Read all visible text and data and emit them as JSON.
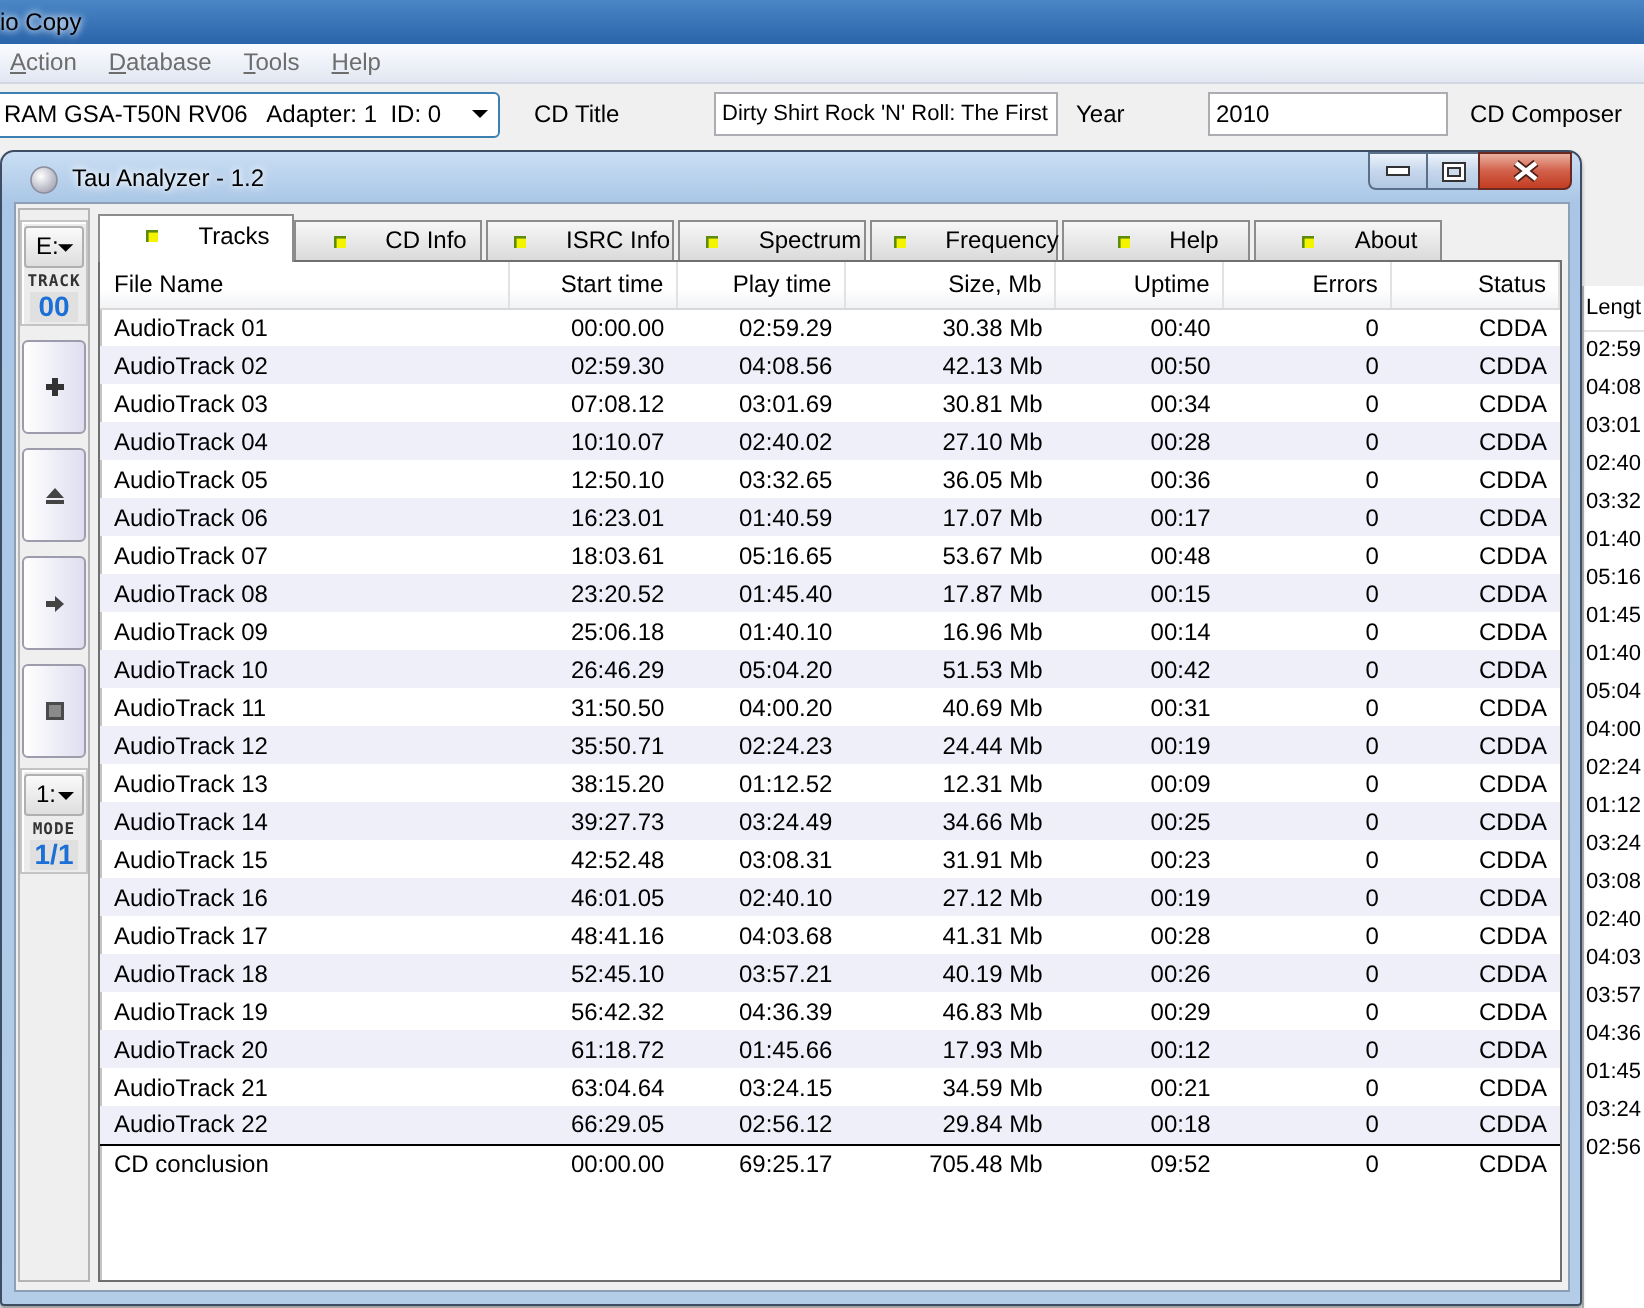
{
  "app_window": {
    "title": "io Copy",
    "menu": [
      "Action",
      "Database",
      "Tools",
      "Help"
    ],
    "device_select": {
      "value": "RAM GSA-T50N RV06   Adapter: 1  ID: 0"
    },
    "fields": [
      {
        "label": "CD Title",
        "value": "Dirty Shirt Rock 'N' Roll: The First"
      },
      {
        "label": "Year",
        "value": "2010"
      },
      {
        "label": "CD Composer"
      }
    ],
    "track_list": {
      "columns": [
        "Lengt"
      ],
      "rows": [
        "02:59",
        "04:08",
        "03:01",
        "02:40",
        "03:32",
        "01:40",
        "05:16",
        "01:45",
        "01:40",
        "05:04",
        "04:00",
        "02:24",
        "01:12",
        "03:24",
        "03:08",
        "02:40",
        "04:03",
        "03:57",
        "04:36",
        "01:45",
        "03:24",
        "02:56"
      ]
    }
  },
  "analyzer_window": {
    "title": "Tau Analyzer - 1.2",
    "toolbar": {
      "drive_select": "E:",
      "track_label": "TRACK",
      "track": "00",
      "buttons": [
        {
          "kind": "add"
        },
        {
          "kind": "eject"
        },
        {
          "kind": "next"
        },
        {
          "kind": "stop"
        }
      ],
      "mode_select": "1:",
      "mode_label": "MODE",
      "mode": "1/1"
    },
    "tabs": [
      {
        "label": "Tracks",
        "selected": true
      },
      {
        "label": "CD Info",
        "selected": false
      },
      {
        "label": "ISRC Info",
        "selected": false
      },
      {
        "label": "Spectrum",
        "selected": false
      },
      {
        "label": "Frequency",
        "selected": false
      },
      {
        "label": "Help",
        "selected": false
      },
      {
        "label": "About",
        "selected": false
      }
    ],
    "table": {
      "columns": [
        "File Name",
        "Start time",
        "Play time",
        "Size, Mb",
        "Uptime",
        "Errors",
        "Status"
      ],
      "rows": [
        [
          "AudioTrack 01",
          "00:00.00",
          "02:59.29",
          "30.38 Mb",
          "00:40",
          "0",
          "CDDA"
        ],
        [
          "AudioTrack 02",
          "02:59.30",
          "04:08.56",
          "42.13 Mb",
          "00:50",
          "0",
          "CDDA"
        ],
        [
          "AudioTrack 03",
          "07:08.12",
          "03:01.69",
          "30.81 Mb",
          "00:34",
          "0",
          "CDDA"
        ],
        [
          "AudioTrack 04",
          "10:10.07",
          "02:40.02",
          "27.10 Mb",
          "00:28",
          "0",
          "CDDA"
        ],
        [
          "AudioTrack 05",
          "12:50.10",
          "03:32.65",
          "36.05 Mb",
          "00:36",
          "0",
          "CDDA"
        ],
        [
          "AudioTrack 06",
          "16:23.01",
          "01:40.59",
          "17.07 Mb",
          "00:17",
          "0",
          "CDDA"
        ],
        [
          "AudioTrack 07",
          "18:03.61",
          "05:16.65",
          "53.67 Mb",
          "00:48",
          "0",
          "CDDA"
        ],
        [
          "AudioTrack 08",
          "23:20.52",
          "01:45.40",
          "17.87 Mb",
          "00:15",
          "0",
          "CDDA"
        ],
        [
          "AudioTrack 09",
          "25:06.18",
          "01:40.10",
          "16.96 Mb",
          "00:14",
          "0",
          "CDDA"
        ],
        [
          "AudioTrack 10",
          "26:46.29",
          "05:04.20",
          "51.53 Mb",
          "00:42",
          "0",
          "CDDA"
        ],
        [
          "AudioTrack 11",
          "31:50.50",
          "04:00.20",
          "40.69 Mb",
          "00:31",
          "0",
          "CDDA"
        ],
        [
          "AudioTrack 12",
          "35:50.71",
          "02:24.23",
          "24.44 Mb",
          "00:19",
          "0",
          "CDDA"
        ],
        [
          "AudioTrack 13",
          "38:15.20",
          "01:12.52",
          "12.31 Mb",
          "00:09",
          "0",
          "CDDA"
        ],
        [
          "AudioTrack 14",
          "39:27.73",
          "03:24.49",
          "34.66 Mb",
          "00:25",
          "0",
          "CDDA"
        ],
        [
          "AudioTrack 15",
          "42:52.48",
          "03:08.31",
          "31.91 Mb",
          "00:23",
          "0",
          "CDDA"
        ],
        [
          "AudioTrack 16",
          "46:01.05",
          "02:40.10",
          "27.12 Mb",
          "00:19",
          "0",
          "CDDA"
        ],
        [
          "AudioTrack 17",
          "48:41.16",
          "04:03.68",
          "41.31 Mb",
          "00:28",
          "0",
          "CDDA"
        ],
        [
          "AudioTrack 18",
          "52:45.10",
          "03:57.21",
          "40.19 Mb",
          "00:26",
          "0",
          "CDDA"
        ],
        [
          "AudioTrack 19",
          "56:42.32",
          "04:36.39",
          "46.83 Mb",
          "00:29",
          "0",
          "CDDA"
        ],
        [
          "AudioTrack 20",
          "61:18.72",
          "01:45.66",
          "17.93 Mb",
          "00:12",
          "0",
          "CDDA"
        ],
        [
          "AudioTrack 21",
          "63:04.64",
          "03:24.15",
          "34.59 Mb",
          "00:21",
          "0",
          "CDDA"
        ],
        [
          "AudioTrack 22",
          "66:29.05",
          "02:56.12",
          "29.84 Mb",
          "00:18",
          "0",
          "CDDA"
        ]
      ],
      "summary": [
        "CD conclusion",
        "00:00.00",
        "69:25.17",
        "705.48 Mb",
        "09:52",
        "0",
        "CDDA"
      ]
    }
  }
}
